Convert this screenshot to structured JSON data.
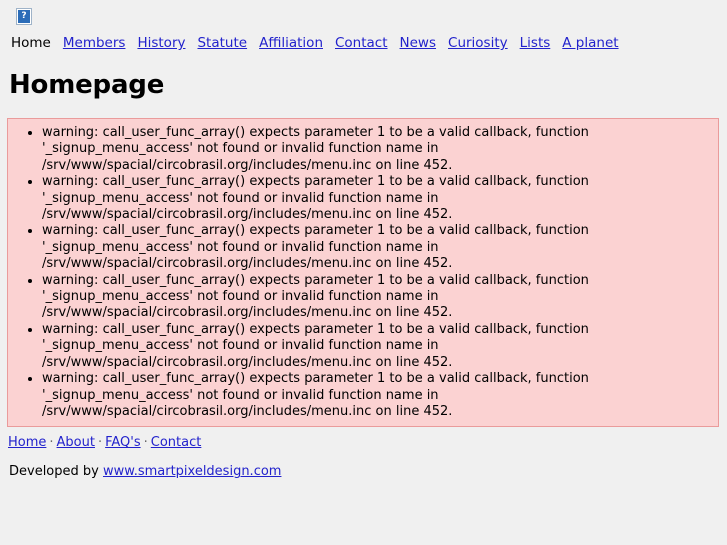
{
  "colors": {
    "page_background": "#f0f0f0",
    "link": "#2222cc",
    "message_background": "#fbd2d2",
    "message_border": "#ea9b9b",
    "logo_tile": "#2b6cb8"
  },
  "header": {
    "logo": {
      "icon": "broken-image-icon",
      "glyph": "?"
    }
  },
  "nav": {
    "items": [
      {
        "label": "Home",
        "current": true
      },
      {
        "label": "Members",
        "current": false
      },
      {
        "label": "History",
        "current": false
      },
      {
        "label": "Statute",
        "current": false
      },
      {
        "label": "Affiliation",
        "current": false
      },
      {
        "label": "Contact",
        "current": false
      },
      {
        "label": "News",
        "current": false
      },
      {
        "label": "Curiosity",
        "current": false
      },
      {
        "label": "Lists",
        "current": false
      },
      {
        "label": "A planet",
        "current": false
      }
    ]
  },
  "main": {
    "title": "Homepage",
    "messages": {
      "type": "warning",
      "items": [
        "warning: call_user_func_array() expects parameter 1 to be a valid callback, function '_signup_menu_access' not found or invalid function name in /srv/www/spacial/circobrasil.org/includes/menu.inc on line 452.",
        "warning: call_user_func_array() expects parameter 1 to be a valid callback, function '_signup_menu_access' not found or invalid function name in /srv/www/spacial/circobrasil.org/includes/menu.inc on line 452.",
        "warning: call_user_func_array() expects parameter 1 to be a valid callback, function '_signup_menu_access' not found or invalid function name in /srv/www/spacial/circobrasil.org/includes/menu.inc on line 452.",
        "warning: call_user_func_array() expects parameter 1 to be a valid callback, function '_signup_menu_access' not found or invalid function name in /srv/www/spacial/circobrasil.org/includes/menu.inc on line 452.",
        "warning: call_user_func_array() expects parameter 1 to be a valid callback, function '_signup_menu_access' not found or invalid function name in /srv/www/spacial/circobrasil.org/includes/menu.inc on line 452.",
        "warning: call_user_func_array() expects parameter 1 to be a valid callback, function '_signup_menu_access' not found or invalid function name in /srv/www/spacial/circobrasil.org/includes/menu.inc on line 452."
      ]
    }
  },
  "footer": {
    "separator": "·",
    "links": [
      {
        "label": "Home"
      },
      {
        "label": "About"
      },
      {
        "label": "FAQ's"
      },
      {
        "label": "Contact"
      }
    ],
    "credit_prefix": "Developed by ",
    "credit_link": "www.smartpixeldesign.com"
  }
}
